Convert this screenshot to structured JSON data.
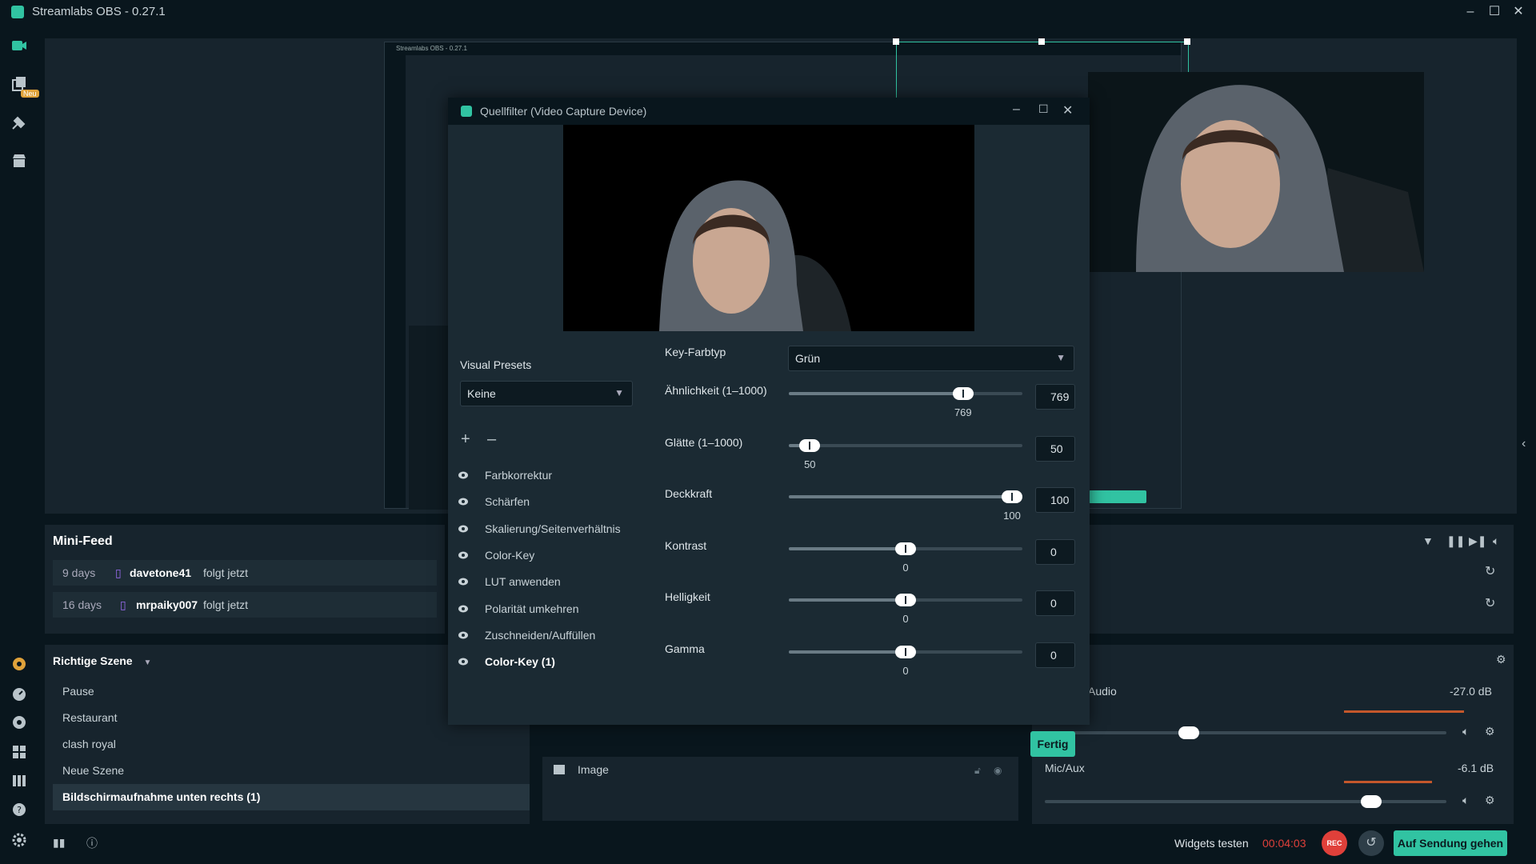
{
  "app": {
    "title": "Streamlabs OBS - 0.27.1"
  },
  "nav": {
    "badge": "Neu"
  },
  "nested": {
    "title": "Streamlabs OBS - 0.27.1"
  },
  "minifeed": {
    "title": "Mini-Feed",
    "rows": [
      {
        "time": "9 days",
        "user": "davetone41",
        "action": "folgt jetzt"
      },
      {
        "time": "16 days",
        "user": "mrpaiky007",
        "action": "folgt jetzt"
      }
    ]
  },
  "scenes": {
    "title": "Richtige Szene",
    "items": [
      "Pause",
      "Restaurant",
      "clash royal",
      "Neue Szene",
      "Bildschirmaufnahme unten rechts (1)"
    ],
    "active_index": 4
  },
  "sources": {
    "item": "Image"
  },
  "mixer": {
    "tracks": [
      {
        "name": "Audio",
        "level": "-27.0 dB",
        "fader": 0.35
      },
      {
        "name": "Mic/Aux",
        "level": "-6.1 dB",
        "fader": 0.83
      }
    ]
  },
  "status": {
    "widgets": "Widgets testen",
    "timer": "00:04:03",
    "rec": "REC",
    "golive": "Auf Sendung gehen"
  },
  "dialog": {
    "title": "Quellfilter (Video Capture Device)",
    "presets_label": "Visual Presets",
    "presets_value": "Keine",
    "filters": [
      "Farbkorrektur",
      "Schärfen",
      "Skalierung/Seitenverhältnis",
      "Color-Key",
      "LUT anwenden",
      "Polarität umkehren",
      "Zuschneiden/Auffüllen",
      "Color-Key (1)"
    ],
    "active_filter": 7,
    "keytype_label": "Key-Farbtyp",
    "keytype_value": "Grün",
    "sliders": [
      {
        "label": "Ähnlichkeit (1–1000)",
        "value": "769",
        "fraction": 0.77
      },
      {
        "label": "Glätte (1–1000)",
        "value": "50",
        "fraction": 0.05
      },
      {
        "label": "Deckkraft",
        "value": "100",
        "fraction": 1.0
      },
      {
        "label": "Kontrast",
        "value": "0",
        "fraction": 0.5
      },
      {
        "label": "Helligkeit",
        "value": "0",
        "fraction": 0.5
      },
      {
        "label": "Gamma",
        "value": "0",
        "fraction": 0.5
      }
    ],
    "done": "Fertig"
  },
  "colors": {
    "accent": "#31c3a2",
    "rec": "#e0403a",
    "timer": "#e0403a"
  }
}
